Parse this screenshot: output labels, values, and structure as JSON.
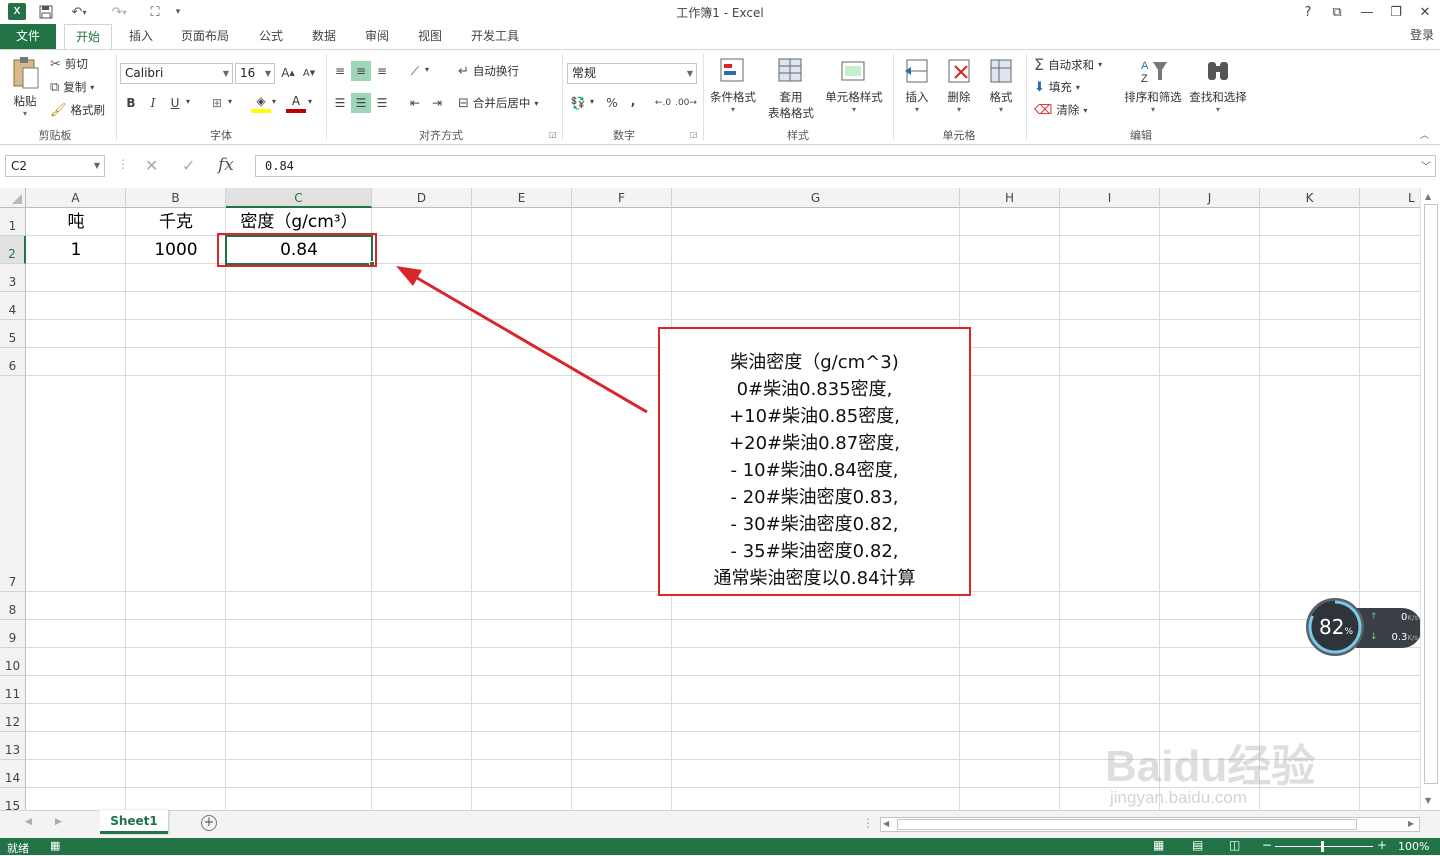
{
  "window": {
    "title": "工作簿1 - Excel",
    "signin": "登录"
  },
  "title_icons": {
    "help": "?",
    "restore": "⧉",
    "minimize": "—",
    "maximize": "❐",
    "close": "✕"
  },
  "tabs": [
    {
      "label": "文件"
    },
    {
      "label": "开始"
    },
    {
      "label": "插入"
    },
    {
      "label": "页面布局"
    },
    {
      "label": "公式"
    },
    {
      "label": "数据"
    },
    {
      "label": "审阅"
    },
    {
      "label": "视图"
    },
    {
      "label": "开发工具"
    }
  ],
  "ribbon": {
    "clipboard": {
      "group": "剪贴板",
      "paste": "粘贴",
      "cut": "剪切",
      "copy": "复制",
      "format_painter": "格式刷"
    },
    "font": {
      "group": "字体",
      "name": "Calibri",
      "size": "16",
      "bold": "B",
      "italic": "I",
      "underline": "U"
    },
    "alignment": {
      "group": "对齐方式",
      "wrap": "自动换行",
      "merge": "合并后居中"
    },
    "number": {
      "group": "数字",
      "format": "常规",
      "percent": "%",
      "comma": ","
    },
    "styles": {
      "group": "样式",
      "conditional": "条件格式",
      "table1": "套用",
      "table2": "表格格式",
      "cell_styles": "单元格样式"
    },
    "cells": {
      "group": "单元格",
      "insert": "插入",
      "delete": "删除",
      "format": "格式"
    },
    "editing": {
      "group": "编辑",
      "autosum": "自动求和",
      "fill": "填充",
      "clear": "清除",
      "sort": "排序和筛选",
      "find": "查找和选择"
    }
  },
  "formula_bar": {
    "name_box": "C2",
    "fx": "fx",
    "value": "0.84"
  },
  "columns": [
    "A",
    "B",
    "C",
    "D",
    "E",
    "F",
    "G",
    "H",
    "I",
    "J",
    "K",
    "L"
  ],
  "rows": [
    "1",
    "2",
    "3",
    "4",
    "5",
    "6",
    "7",
    "8",
    "9",
    "10",
    "11",
    "12",
    "13",
    "14",
    "15"
  ],
  "cells": {
    "A1": "吨",
    "B1": "千克",
    "C1": "密度（g/cm³）",
    "A2": "1",
    "B2": "1000",
    "C2": "0.84"
  },
  "callout": {
    "lines": [
      "柴油密度（g/cm^3)",
      "0#柴油0.835密度,",
      "+10#柴油0.85密度,",
      "+20#柴油0.87密度,",
      "- 10#柴油0.84密度,",
      "- 20#柴油密度0.83,",
      "- 30#柴油密度0.82,",
      "- 35#柴油密度0.82,",
      "通常柴油密度以0.84计算"
    ]
  },
  "annotation_color": "#d9262c",
  "accent": "#217346",
  "sheet_tabs": [
    {
      "label": "Sheet1"
    }
  ],
  "status": {
    "ready": "就绪",
    "zoom": "100%"
  },
  "net_widget": {
    "percent": "82",
    "unit": "%",
    "up": "0",
    "down": "0.3",
    "rate_unit": "K/s"
  },
  "watermark": {
    "brand": "Baidu经验",
    "url": "jingyan.baidu.com"
  }
}
